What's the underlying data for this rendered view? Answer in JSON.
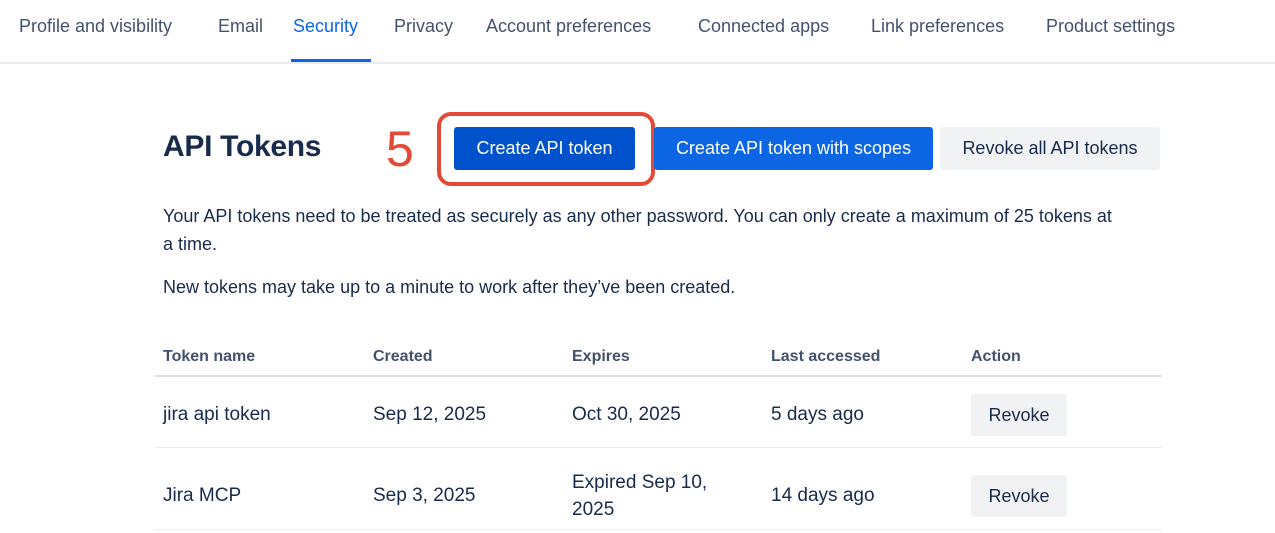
{
  "tabs": [
    {
      "label": "Profile and visibility",
      "active": false
    },
    {
      "label": "Email",
      "active": false
    },
    {
      "label": "Security",
      "active": true
    },
    {
      "label": "Privacy",
      "active": false
    },
    {
      "label": "Account preferences",
      "active": false
    },
    {
      "label": "Connected apps",
      "active": false
    },
    {
      "label": "Link preferences",
      "active": false
    },
    {
      "label": "Product settings",
      "active": false
    }
  ],
  "header": {
    "title": "API Tokens",
    "annotation_number": "5",
    "create_token_label": "Create API token",
    "create_scoped_token_label": "Create API token with scopes",
    "revoke_all_label": "Revoke all API tokens"
  },
  "description": {
    "line1": "Your API tokens need to be treated as securely as any other password. You can only create a maximum of 25 tokens at a time.",
    "line2": "New tokens may take up to a minute to work after they’ve been created."
  },
  "table": {
    "columns": [
      "Token name",
      "Created",
      "Expires",
      "Last accessed",
      "Action"
    ],
    "rows": [
      {
        "name": "jira api token",
        "created": "Sep 12, 2025",
        "expires": "Oct 30, 2025",
        "last_accessed": "5 days ago",
        "action": "Revoke"
      },
      {
        "name": "Jira MCP",
        "created": "Sep 3, 2025",
        "expires": "Expired Sep 10, 2025",
        "last_accessed": "14 days ago",
        "action": "Revoke"
      }
    ]
  },
  "colors": {
    "accent": "#0c66e4",
    "annotation": "#e34935"
  }
}
